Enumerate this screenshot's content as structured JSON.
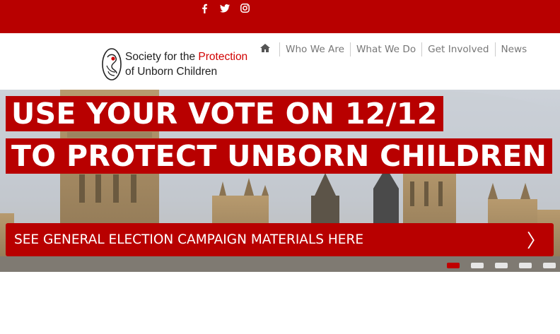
{
  "social": {
    "facebook_icon": "facebook-icon",
    "twitter_icon": "twitter-icon",
    "instagram_icon": "instagram-icon"
  },
  "logo": {
    "line1_prefix": "Society for the ",
    "line1_highlight": "Protection",
    "line2": "of Unborn Children"
  },
  "nav": {
    "home_icon": "home-icon",
    "items": [
      "Who We Are",
      "What We Do",
      "Get Involved",
      "News"
    ]
  },
  "hero": {
    "headline_1": "USE YOUR VOTE ON 12/12",
    "headline_2": "TO PROTECT UNBORN CHILDREN",
    "cta_label": "SEE GENERAL ELECTION CAMPAIGN MATERIALS HERE",
    "cta_arrow": "〉",
    "slides_total": 5,
    "active_slide": 1
  },
  "colors": {
    "brand_red": "#b80000",
    "highlight_red": "#d10000",
    "nav_text": "#777777"
  }
}
